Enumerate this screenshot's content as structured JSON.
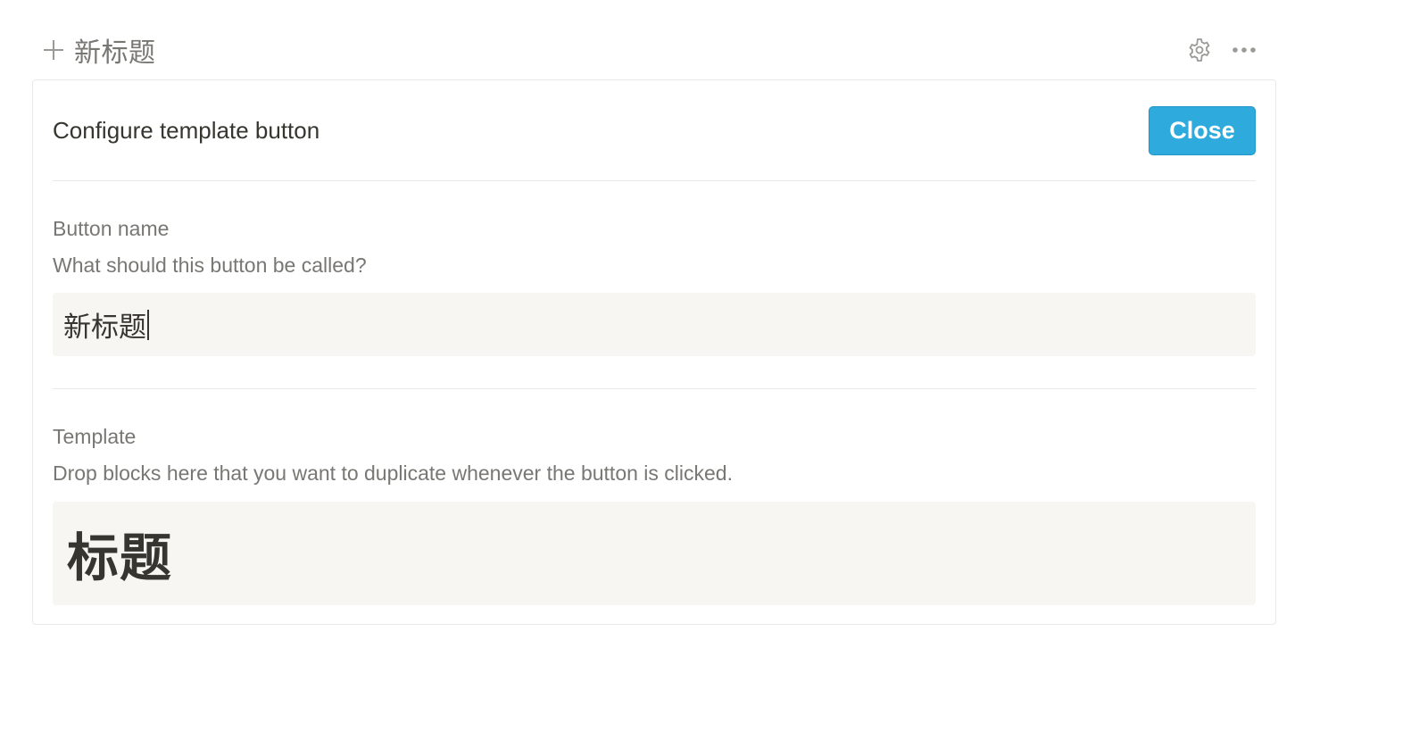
{
  "template_button": {
    "label": "新标题",
    "plus_icon": "plus-icon",
    "settings_icon": "gear-icon",
    "more_icon": "more-horizontal-icon"
  },
  "config_panel": {
    "title": "Configure template button",
    "close_label": "Close",
    "accent_color": "#2eaadc",
    "button_name": {
      "label": "Button name",
      "description": "What should this button be called?",
      "value": "新标题"
    },
    "template": {
      "label": "Template",
      "description": "Drop blocks here that you want to duplicate whenever the button is clicked.",
      "heading_block": "标题"
    }
  }
}
